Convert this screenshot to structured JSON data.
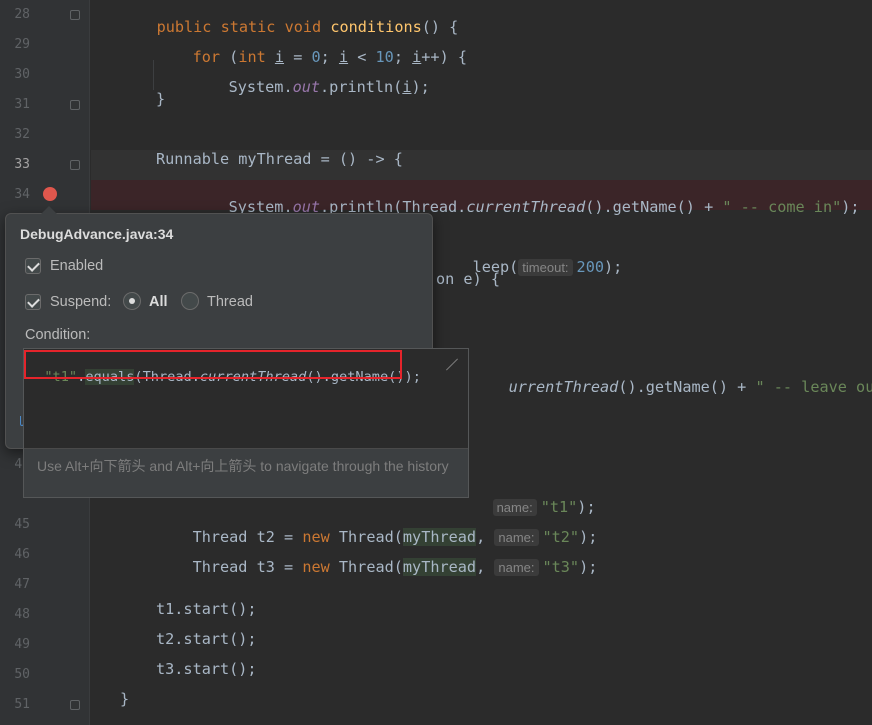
{
  "gutter": {
    "line_numbers": [
      "28",
      "29",
      "30",
      "31",
      "32",
      "33",
      "34",
      "",
      "",
      "",
      "",
      "",
      "",
      "",
      "",
      "45",
      "46",
      "47",
      "48",
      "49",
      "50",
      "51"
    ]
  },
  "code": {
    "l28": {
      "kw1": "public static void ",
      "fn": "conditions",
      "rest": "() {"
    },
    "l29": {
      "kw": "for ",
      "p1": "(",
      "kw2": "int ",
      "v1": "i",
      "p2": " = ",
      "n1": "0",
      "p3": "; ",
      "v2": "i",
      "p4": " < ",
      "n2": "10",
      "p5": "; ",
      "v3": "i",
      "p6": "++) {"
    },
    "l30": {
      "a": "System.",
      "b": "out",
      "c": ".println(",
      "d": "i",
      "e": ");"
    },
    "l31": {
      "a": "}"
    },
    "l33": {
      "a": "Runnable myThread = () -> {"
    },
    "l34": {
      "a": "System.",
      "b": "out",
      "c": ".println(Thread.",
      "d": "currentThread",
      "e": "().getName() + ",
      "f": "\" -- come in\"",
      "g": ");"
    },
    "l36": {
      "a": "leep(",
      "hint": "timeout:",
      "n": "200",
      "b": ");"
    },
    "l37": {
      "a": "on e) {"
    },
    "l39": {
      "a": "urrentThread",
      "b": "().getName() + ",
      "c": "\" -- leave out\"",
      "d": ");"
    },
    "l44": {
      "hint": "name:",
      "s": "\"t1\"",
      "b": ");"
    },
    "l45": {
      "a": "Thread t2 = ",
      "kw": "new ",
      "b": "Thread(",
      "c": "myThread",
      "d": ", ",
      "hint": "name:",
      "s": "\"t2\"",
      "e": ");"
    },
    "l46": {
      "a": "Thread t3 = ",
      "kw": "new ",
      "b": "Thread(",
      "c": "myThread",
      "d": ", ",
      "hint": "name:",
      "s": "\"t3\"",
      "e": ");"
    },
    "l48": {
      "a": "t1.start();"
    },
    "l49": {
      "a": "t2.start();"
    },
    "l50": {
      "a": "t3.start();"
    },
    "l51": {
      "a": "}"
    }
  },
  "popup": {
    "title": "DebugAdvance.java:34",
    "enabled_label": "Enabled",
    "suspend_label": "Suspend:",
    "all_label": "All",
    "thread_label": "Thread",
    "condition_label": "Condition:",
    "condition": {
      "s": "\"t1\"",
      "a": ".",
      "b": "equals",
      "c": "(Thread.",
      "d": "currentThread",
      "e": "().getName());"
    },
    "history_hint": "Use Alt+向下箭头 and Alt+向上箭头 to navigate through the history",
    "enabled_checked": true,
    "suspend_checked": true,
    "suspend_mode": "All"
  },
  "colors": {
    "background": "#2b2b2b",
    "keyword": "#cc7832",
    "string": "#6a8759",
    "number": "#6897bb",
    "breakpoint": "#e0574d",
    "highlight_border": "#e5242b"
  }
}
